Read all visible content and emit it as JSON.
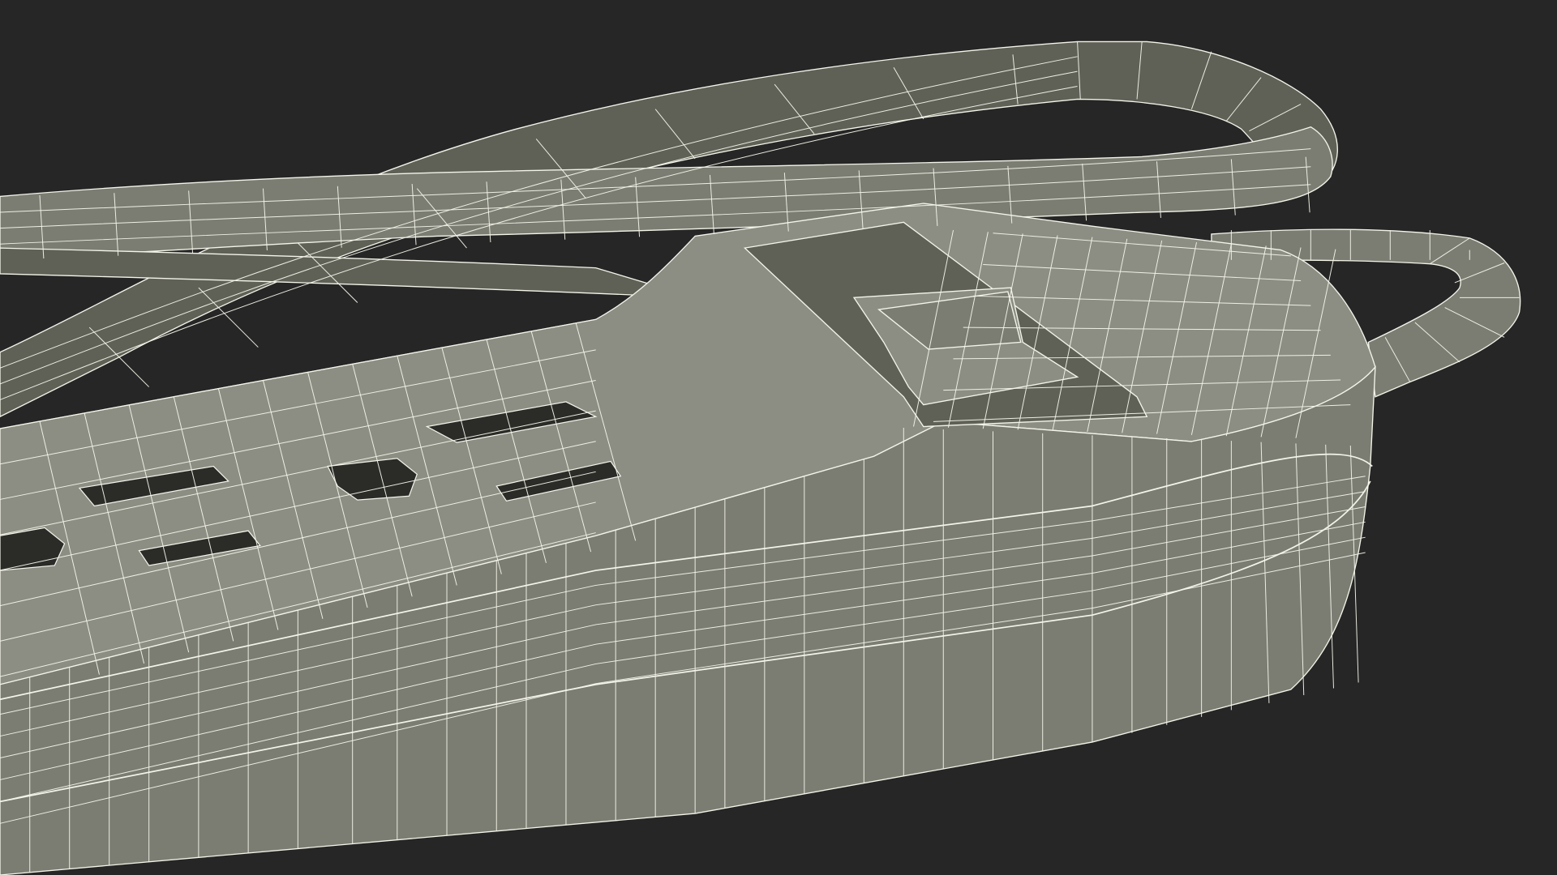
{
  "scene": {
    "subject": "power-strip-wireframe",
    "background_color": "#262626",
    "surface_color": "#7b7d72",
    "surface_shadow_color": "#5f6157",
    "surface_highlight_color": "#8c8e83",
    "wire_color": "#f4f4ea",
    "slot_color": "#2b2c28"
  }
}
